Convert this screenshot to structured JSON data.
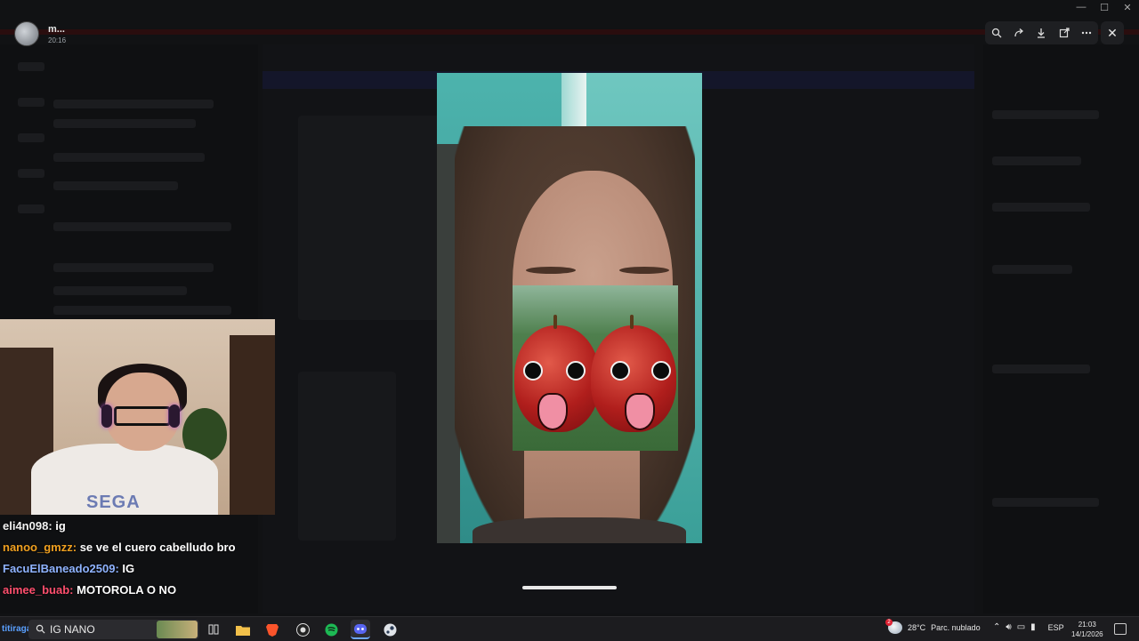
{
  "viewer": {
    "user_name": "m...",
    "time": "20:16",
    "tools": [
      "zoom-icon",
      "forward-icon",
      "download-icon",
      "open-external-icon",
      "more-icon"
    ],
    "close_label": "✕"
  },
  "window_controls": [
    "—",
    "☐",
    "✕"
  ],
  "stream_chat": [
    {
      "user": "eli4n098",
      "color": "#f2f2f2",
      "text": " ig"
    },
    {
      "user": "nanoo_gmzz",
      "color": "#f0a020",
      "text": " se ve el cuero cabelludo bro"
    },
    {
      "user": "FacuElBaneado2509",
      "color": "#8fb3ff",
      "text": " IG"
    },
    {
      "user": "aimee_buab",
      "color": "#ff4f6e",
      "text": " MOTOROLA O NO"
    }
  ],
  "webcam": {
    "shirt_text": "SEGA"
  },
  "taskbar": {
    "ticker": "titiraga",
    "search_label": "IG NANO",
    "apps": [
      "task-view-icon",
      "file-explorer-icon",
      "brave-browser-icon",
      "obs-icon",
      "spotify-icon",
      "discord-icon",
      "steam-icon"
    ],
    "weather_temp": "28°C",
    "weather_text": "Parc. nublado",
    "weather_badge": "2",
    "language": "ESP",
    "time": "21:03",
    "date": "14/1/2026"
  },
  "colors": {
    "accent": "#6ea8ff",
    "background": "#0a0a0c"
  }
}
